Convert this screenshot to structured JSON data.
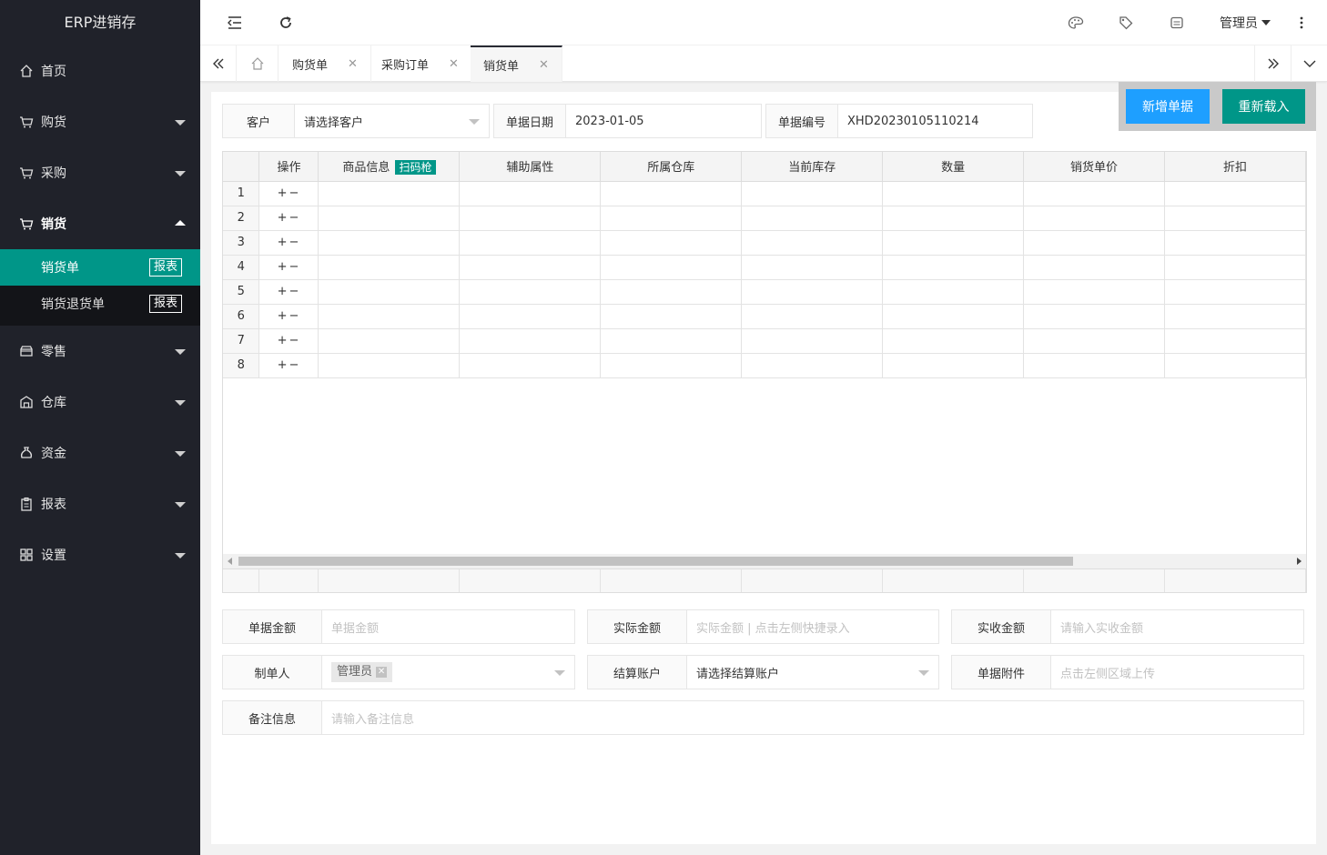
{
  "app": {
    "title": "ERP进销存"
  },
  "sidebar": {
    "items": [
      {
        "label": "首页",
        "icon": "home-icon"
      },
      {
        "label": "购货",
        "icon": "cart-icon"
      },
      {
        "label": "采购",
        "icon": "cart-icon"
      },
      {
        "label": "销货",
        "icon": "cart-icon",
        "open": true,
        "children": [
          {
            "label": "销货单",
            "badge": "报表",
            "active": true
          },
          {
            "label": "销货退货单",
            "badge": "报表"
          }
        ]
      },
      {
        "label": "零售",
        "icon": "store-icon"
      },
      {
        "label": "仓库",
        "icon": "warehouse-icon"
      },
      {
        "label": "资金",
        "icon": "money-bag-icon"
      },
      {
        "label": "报表",
        "icon": "clipboard-icon"
      },
      {
        "label": "设置",
        "icon": "grid-icon"
      }
    ]
  },
  "header": {
    "user": "管理员"
  },
  "tabs": [
    {
      "label": "购货单"
    },
    {
      "label": "采购订单"
    },
    {
      "label": "销货单",
      "active": true
    }
  ],
  "form": {
    "customer_label": "客户",
    "customer_placeholder": "请选择客户",
    "date_label": "单据日期",
    "date_value": "2023-01-05",
    "number_label": "单据编号",
    "number_value": "XHD20230105110214",
    "new_button": "新增单据",
    "reload_button": "重新载入"
  },
  "grid": {
    "columns": [
      "操作",
      "商品信息",
      "辅助属性",
      "所属仓库",
      "当前库存",
      "数量",
      "销货单价",
      "折扣"
    ],
    "scan_tag": "扫码枪",
    "rows": [
      "1",
      "2",
      "3",
      "4",
      "5",
      "6",
      "7",
      "8"
    ],
    "op_symbol": "+−"
  },
  "summary": {
    "bill_amount_label": "单据金额",
    "bill_amount_placeholder": "单据金额",
    "actual_amount_label": "实际金额",
    "actual_amount_placeholder": "实际金额 | 点击左侧快捷录入",
    "received_label": "实收金额",
    "received_placeholder": "请输入实收金额",
    "maker_label": "制单人",
    "maker_value": "管理员",
    "account_label": "结算账户",
    "account_placeholder": "请选择结算账户",
    "attachment_label": "单据附件",
    "attachment_placeholder": "点击左侧区域上传",
    "note_label": "备注信息",
    "note_placeholder": "请输入备注信息"
  },
  "colors": {
    "sidebar_bg": "#20222a",
    "accent": "#009688",
    "primary": "#1e9fff"
  }
}
